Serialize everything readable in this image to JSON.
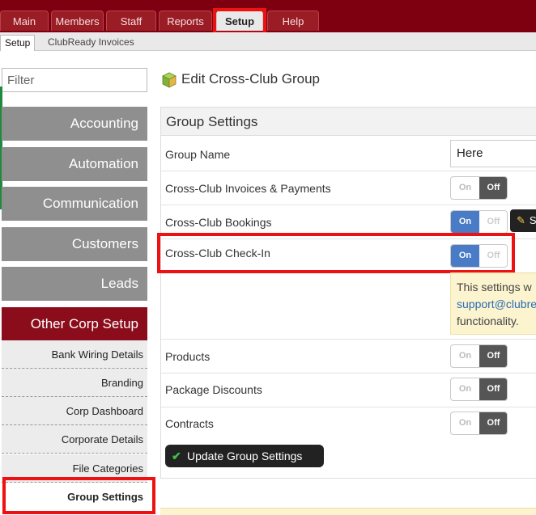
{
  "nav": {
    "tabs": [
      {
        "label": "Main"
      },
      {
        "label": "Members"
      },
      {
        "label": "Staff"
      },
      {
        "label": "Reports"
      },
      {
        "label": "Setup",
        "active": true
      },
      {
        "label": "Help"
      }
    ],
    "subtabs": [
      {
        "label": "Setup",
        "active": true
      },
      {
        "label": "ClubReady Invoices"
      }
    ]
  },
  "sidebar": {
    "filter_placeholder": "Filter",
    "sections": [
      "Accounting",
      "Automation",
      "Communication",
      "Customers",
      "Leads",
      "Other Corp Setup"
    ],
    "subitems": [
      "Bank Wiring Details",
      "Branding",
      "Corp Dashboard",
      "Corporate Details",
      "File Categories",
      "Group Settings"
    ],
    "selected": "Group Settings"
  },
  "page": {
    "title": "Edit Cross-Club Group",
    "panel_title": "Group Settings",
    "group_name_label": "Group Name",
    "group_name_value": "Here",
    "rows": [
      {
        "label": "Cross-Club Invoices & Payments",
        "state": "Off"
      },
      {
        "label": "Cross-Club Bookings",
        "state": "On"
      },
      {
        "label": "Cross-Club Check-In",
        "state": "On"
      },
      {
        "label": "Products",
        "state": "Off"
      },
      {
        "label": "Package Discounts",
        "state": "Off"
      },
      {
        "label": "Contracts",
        "state": "Off"
      }
    ],
    "toggle_on_label": "On",
    "toggle_off_label": "Off",
    "tooltip_text": "S",
    "notice": {
      "line1": "This settings w",
      "link": "support@clubre",
      "line3": "functionality."
    },
    "update_button": "Update Group Settings"
  },
  "colors": {
    "brand": "#7e0010",
    "highlight": "#ee1111",
    "toggle_on": "#4a7bc6",
    "toggle_off": "#555555",
    "notice_bg": "#fcf3cf"
  },
  "icons": {
    "page": "cube-stack-icon",
    "tooltip": "pencil-icon",
    "update": "checkmark-icon"
  }
}
